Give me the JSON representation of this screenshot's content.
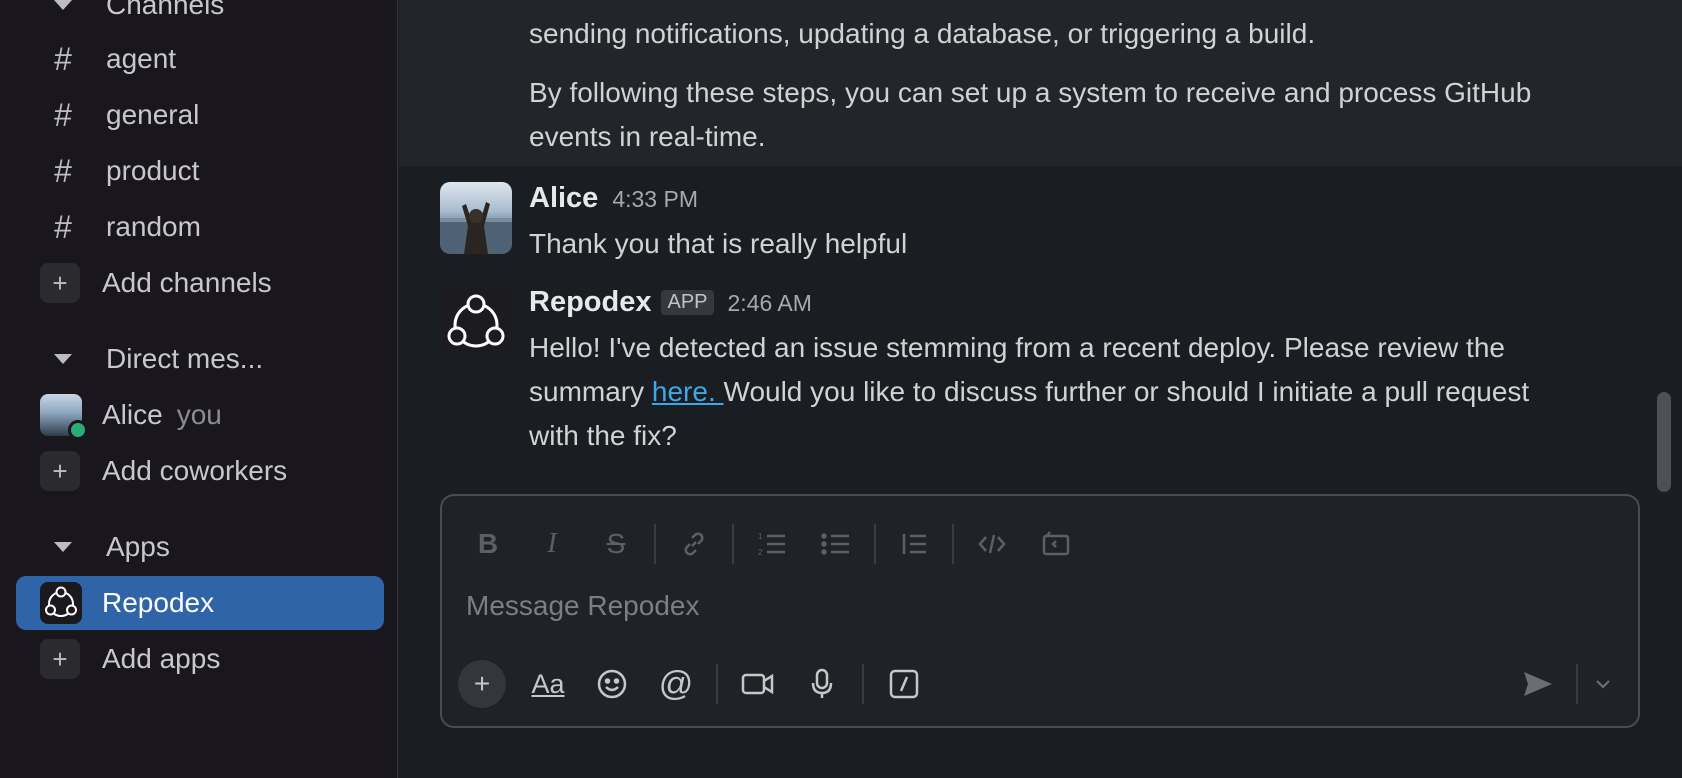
{
  "sidebar": {
    "channels_header": "Channels",
    "channels": [
      {
        "label": "agent"
      },
      {
        "label": "general"
      },
      {
        "label": "product"
      },
      {
        "label": "random"
      }
    ],
    "add_channels": "Add channels",
    "dm_header": "Direct mes...",
    "dm_items": [
      {
        "name": "Alice",
        "tag": "you"
      }
    ],
    "add_coworkers": "Add coworkers",
    "apps_header": "Apps",
    "apps": [
      {
        "label": "Repodex"
      }
    ],
    "add_apps": "Add apps"
  },
  "previous_message": {
    "line1": "sending notifications, updating a database, or triggering a build.",
    "para2_line1": "By following these steps, you can set up a system to receive and process GitHub",
    "para2_line2": "events in real-time."
  },
  "messages": [
    {
      "author": "Alice",
      "time": "4:33 PM",
      "text": "Thank you that is really helpful"
    },
    {
      "author": "Repodex",
      "badge": "APP",
      "time": "2:46 AM",
      "line1": "Hello! I've detected an issue stemming from a recent deploy. Please review the",
      "line2_pre": "summary ",
      "link": "here. ",
      "line2_post": "Would you like to discuss further or should I initiate a pull request",
      "line3": "with the fix?"
    }
  ],
  "composer": {
    "placeholder": "Message Repodex",
    "format_tools": [
      "bold-icon",
      "italic-icon",
      "strikethrough-icon",
      "link-icon",
      "ordered-list-icon",
      "bulleted-list-icon",
      "blockquote-icon",
      "code-icon",
      "code-block-icon"
    ],
    "bottom_tools": [
      "plus-icon",
      "text-format-icon",
      "emoji-icon",
      "mention-icon",
      "video-icon",
      "microphone-icon",
      "slash-command-icon"
    ],
    "format_text_glyph": "Aa"
  },
  "colors": {
    "active_item": "#2f64a8",
    "link": "#3ea8e6",
    "presence": "#2bac76"
  }
}
